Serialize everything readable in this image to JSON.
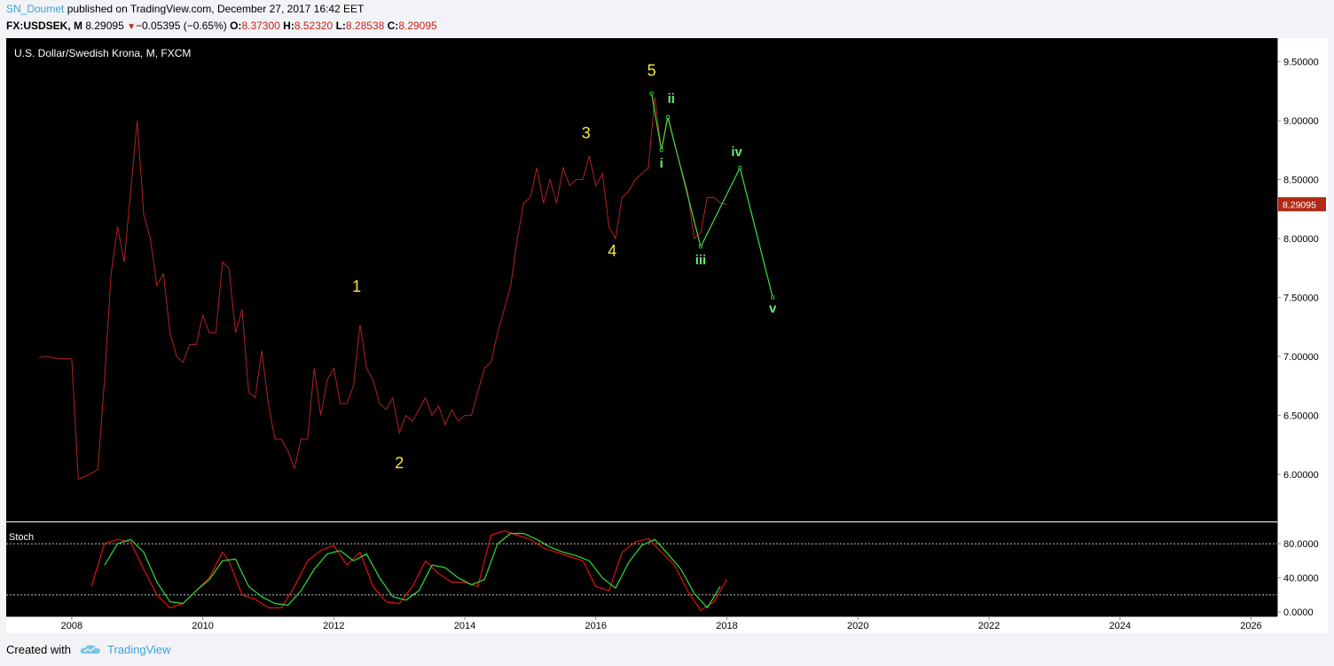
{
  "header": {
    "user": "SN_Doumet",
    "published": "published on TradingView.com, December 27, 2017 16:42 EET",
    "symbol": "FX:USDSEK, M",
    "last": "8.29095",
    "change": "−0.05395 (−0.65%)",
    "open_label": "O:",
    "open": "8.37300",
    "high_label": "H:",
    "high": "8.52320",
    "low_label": "L:",
    "low": "8.28538",
    "close_label": "C:",
    "close": "8.29095"
  },
  "footer": {
    "created_with": "Created with",
    "brand": "TradingView"
  },
  "colors": {
    "background": "#000000",
    "price_line": "#b22222",
    "stoch_k": "#e01010",
    "stoch_d": "#33dd33",
    "wave_main": "#f5e642",
    "wave_sub": "#66ee66",
    "wave_line": "#44dd44",
    "price_tag": "#b22a16"
  },
  "chart_data": [
    {
      "type": "line",
      "title": "U.S. Dollar/Swedish Krona, M, FXCM",
      "xlim": [
        2007.0,
        2026.4
      ],
      "ylim": [
        5.6,
        9.7
      ],
      "x_ticks": [
        "2008",
        "2010",
        "2012",
        "2014",
        "2016",
        "2018",
        "2020",
        "2022",
        "2024",
        "2026"
      ],
      "y_ticks": [
        "9.50000",
        "9.00000",
        "8.50000",
        "8.00000",
        "7.50000",
        "7.00000",
        "6.50000",
        "6.00000"
      ],
      "last_price_tag": "8.29095",
      "series": [
        {
          "x": [
            2007.5,
            2007.6,
            2007.8,
            2007.9,
            2008.0,
            2008.1,
            2008.2,
            2008.4,
            2008.5,
            2008.6,
            2008.7,
            2008.8,
            2008.9,
            2009.0,
            2009.1,
            2009.2,
            2009.3,
            2009.4,
            2009.5,
            2009.6,
            2009.7,
            2009.8,
            2009.9,
            2010.0,
            2010.1,
            2010.2,
            2010.3,
            2010.4,
            2010.5,
            2010.6,
            2010.7,
            2010.8,
            2010.9,
            2011.0,
            2011.1,
            2011.2,
            2011.3,
            2011.4,
            2011.5,
            2011.6,
            2011.7,
            2011.8,
            2011.9,
            2012.0,
            2012.1,
            2012.2,
            2012.3,
            2012.4,
            2012.5,
            2012.6,
            2012.7,
            2012.8,
            2012.9,
            2013.0,
            2013.1,
            2013.2,
            2013.3,
            2013.4,
            2013.5,
            2013.6,
            2013.7,
            2013.8,
            2013.9,
            2014.0,
            2014.1,
            2014.2,
            2014.3,
            2014.4,
            2014.5,
            2014.6,
            2014.7,
            2014.8,
            2014.9,
            2015.0,
            2015.1,
            2015.2,
            2015.3,
            2015.4,
            2015.5,
            2015.6,
            2015.7,
            2015.8,
            2015.9,
            2016.0,
            2016.1,
            2016.2,
            2016.3,
            2016.4,
            2016.5,
            2016.6,
            2016.7,
            2016.8,
            2016.9,
            2017.0,
            2017.1,
            2017.2,
            2017.3,
            2017.4,
            2017.5,
            2017.6,
            2017.7,
            2017.8,
            2017.9,
            2018.0
          ],
          "y": [
            6.99,
            7.0,
            6.98,
            6.98,
            6.98,
            5.96,
            5.98,
            6.04,
            6.8,
            7.7,
            8.1,
            7.8,
            8.4,
            9.0,
            8.2,
            8.0,
            7.6,
            7.7,
            7.2,
            7.0,
            6.95,
            7.1,
            7.1,
            7.35,
            7.2,
            7.2,
            7.8,
            7.75,
            7.2,
            7.4,
            6.7,
            6.65,
            7.05,
            6.6,
            6.3,
            6.3,
            6.2,
            6.05,
            6.3,
            6.3,
            6.9,
            6.5,
            6.8,
            6.9,
            6.6,
            6.6,
            6.75,
            7.27,
            6.9,
            6.8,
            6.6,
            6.55,
            6.65,
            6.35,
            6.5,
            6.45,
            6.55,
            6.65,
            6.5,
            6.58,
            6.42,
            6.55,
            6.45,
            6.5,
            6.5,
            6.7,
            6.9,
            6.95,
            7.2,
            7.4,
            7.6,
            8.0,
            8.3,
            8.35,
            8.6,
            8.3,
            8.5,
            8.3,
            8.6,
            8.45,
            8.5,
            8.5,
            8.7,
            8.45,
            8.55,
            8.1,
            8.0,
            8.35,
            8.4,
            8.5,
            8.55,
            8.6,
            9.2,
            8.75,
            9.05,
            8.8,
            8.6,
            8.4,
            8.0,
            8.05,
            8.35,
            8.35,
            8.3,
            8.29
          ]
        },
        {
          "x": [
            2016.85,
            2017.0,
            2017.1,
            2017.6,
            2018.2,
            2018.7
          ],
          "y": [
            9.23,
            8.75,
            9.03,
            7.93,
            8.6,
            7.5
          ]
        }
      ],
      "annotations": [
        {
          "label": "1",
          "x": 2012.35,
          "y": 7.55
        },
        {
          "label": "2",
          "x": 2013.0,
          "y": 6.05
        },
        {
          "label": "3",
          "x": 2015.85,
          "y": 8.85
        },
        {
          "label": "4",
          "x": 2016.25,
          "y": 7.85
        },
        {
          "label": "5",
          "x": 2016.85,
          "y": 9.38
        },
        {
          "label": "i",
          "x": 2017.0,
          "y": 8.6
        },
        {
          "label": "ii",
          "x": 2017.15,
          "y": 9.15
        },
        {
          "label": "iii",
          "x": 2017.6,
          "y": 7.78
        },
        {
          "label": "iv",
          "x": 2018.15,
          "y": 8.7
        },
        {
          "label": "v",
          "x": 2018.7,
          "y": 7.37
        }
      ]
    },
    {
      "type": "line",
      "title": "Stoch",
      "xlim": [
        2007.0,
        2026.4
      ],
      "ylim": [
        -5,
        105
      ],
      "y_ticks": [
        "80.0000",
        "40.0000",
        "0.0000"
      ],
      "bands": [
        80,
        20
      ],
      "series": [
        {
          "x": [
            2008.3,
            2008.5,
            2008.7,
            2008.9,
            2009.1,
            2009.3,
            2009.5,
            2009.7,
            2009.9,
            2010.1,
            2010.3,
            2010.4,
            2010.6,
            2010.8,
            2011.0,
            2011.2,
            2011.4,
            2011.6,
            2011.8,
            2012.0,
            2012.2,
            2012.4,
            2012.6,
            2012.8,
            2013.0,
            2013.2,
            2013.4,
            2013.6,
            2013.8,
            2014.0,
            2014.2,
            2014.4,
            2014.6,
            2014.8,
            2015.0,
            2015.2,
            2015.4,
            2015.6,
            2015.8,
            2016.0,
            2016.2,
            2016.4,
            2016.6,
            2016.8,
            2017.0,
            2017.2,
            2017.4,
            2017.6,
            2017.8,
            2018.0
          ],
          "y": [
            30,
            80,
            85,
            82,
            50,
            20,
            5,
            10,
            25,
            40,
            70,
            60,
            20,
            15,
            5,
            5,
            30,
            60,
            72,
            78,
            55,
            70,
            30,
            12,
            10,
            30,
            60,
            45,
            35,
            35,
            30,
            90,
            95,
            90,
            85,
            75,
            70,
            65,
            60,
            30,
            25,
            70,
            82,
            86,
            70,
            55,
            25,
            2,
            12,
            38
          ]
        },
        {
          "x": [
            2008.5,
            2008.7,
            2008.9,
            2009.1,
            2009.3,
            2009.5,
            2009.7,
            2009.9,
            2010.1,
            2010.3,
            2010.5,
            2010.7,
            2010.9,
            2011.1,
            2011.3,
            2011.5,
            2011.7,
            2011.9,
            2012.1,
            2012.3,
            2012.5,
            2012.7,
            2012.9,
            2013.1,
            2013.3,
            2013.5,
            2013.7,
            2013.9,
            2014.1,
            2014.3,
            2014.5,
            2014.7,
            2014.9,
            2015.1,
            2015.3,
            2015.5,
            2015.7,
            2015.9,
            2016.1,
            2016.3,
            2016.5,
            2016.7,
            2016.9,
            2017.1,
            2017.3,
            2017.5,
            2017.7,
            2017.9
          ],
          "y": [
            55,
            80,
            85,
            70,
            35,
            12,
            10,
            25,
            38,
            60,
            62,
            30,
            18,
            10,
            8,
            25,
            50,
            68,
            72,
            60,
            68,
            40,
            18,
            14,
            25,
            55,
            52,
            40,
            32,
            38,
            80,
            92,
            92,
            85,
            76,
            70,
            66,
            60,
            40,
            28,
            58,
            78,
            85,
            68,
            50,
            22,
            5,
            30
          ]
        }
      ]
    }
  ]
}
